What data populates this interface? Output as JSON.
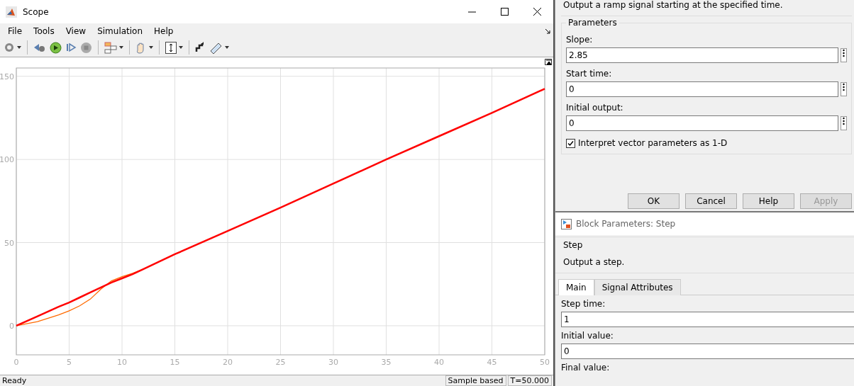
{
  "scope": {
    "title": "Scope",
    "menu": [
      "File",
      "Tools",
      "View",
      "Simulation",
      "Help"
    ],
    "chart_data": {
      "type": "line",
      "grid": true,
      "x": [
        0,
        2,
        4,
        5,
        6,
        7,
        8,
        9,
        10,
        11,
        12,
        15,
        20,
        25,
        30,
        35,
        40,
        45,
        50
      ],
      "xlim": [
        0,
        50
      ],
      "ylim": [
        -17.5,
        155
      ],
      "xticks": [
        0,
        5,
        10,
        15,
        20,
        25,
        30,
        35,
        40,
        45,
        50
      ],
      "yticks": [
        0,
        50,
        100,
        150
      ],
      "series": [
        {
          "color": "#ff0000",
          "values": [
            0,
            5.7,
            11.4,
            14,
            17,
            20,
            23,
            26,
            28.5,
            31,
            34,
            43,
            57,
            71,
            85.5,
            100,
            114,
            128,
            142.5
          ]
        },
        {
          "color": "#ff6a00",
          "values": [
            0,
            2.5,
            6.5,
            9,
            12,
            16,
            22,
            27,
            29.5,
            31.5,
            34,
            null,
            null,
            null,
            null,
            null,
            null,
            null,
            null
          ]
        }
      ]
    },
    "status": [
      "Ready",
      "Sample based",
      "T=50.000"
    ]
  },
  "ramp_dialog": {
    "description": "Output a ramp signal starting at the specified time.",
    "group": "Parameters",
    "fields": [
      {
        "label": "Slope:",
        "value": "2.85"
      },
      {
        "label": "Start time:",
        "value": "0"
      },
      {
        "label": "Initial output:",
        "value": "0"
      }
    ],
    "checkbox": {
      "label": "Interpret vector parameters as 1-D",
      "checked": true
    },
    "buttons": [
      {
        "label": "OK",
        "disabled": false
      },
      {
        "label": "Cancel",
        "disabled": false
      },
      {
        "label": "Help",
        "disabled": false
      },
      {
        "label": "Apply",
        "disabled": true
      }
    ]
  },
  "step_dialog": {
    "title": "Block Parameters: Step",
    "block": "Step",
    "description": "Output a step.",
    "tabs": [
      {
        "label": "Main",
        "selected": true
      },
      {
        "label": "Signal Attributes",
        "selected": false
      }
    ],
    "fields": [
      {
        "label": "Step time:",
        "value": "1"
      },
      {
        "label": "Initial value:",
        "value": "0"
      },
      {
        "label": "Final value:"
      }
    ]
  }
}
